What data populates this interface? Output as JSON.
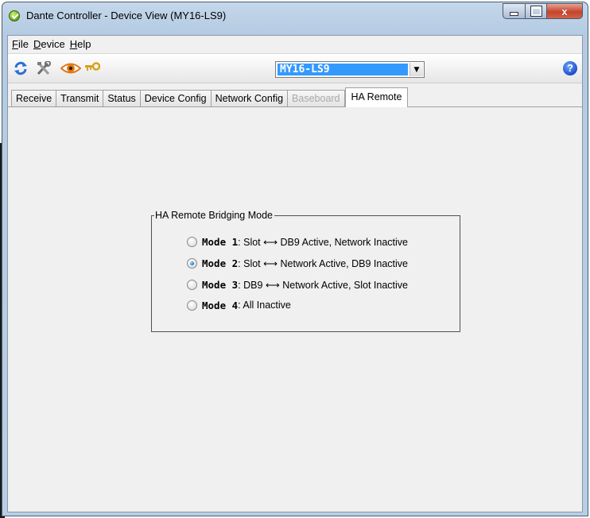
{
  "window": {
    "title": "Dante Controller - Device View (MY16-LS9)",
    "close_glyph": "x"
  },
  "menu": {
    "items": [
      {
        "key": "F",
        "rest": "ile"
      },
      {
        "key": "D",
        "rest": "evice"
      },
      {
        "key": "H",
        "rest": "elp"
      }
    ]
  },
  "toolbar": {
    "icons": [
      "refresh-icon",
      "tools-icon",
      "eye-icon",
      "key-icon"
    ],
    "device": "MY16-LS9",
    "help_label": "?"
  },
  "tabs": [
    {
      "label": "Receive",
      "state": "normal"
    },
    {
      "label": "Transmit",
      "state": "normal"
    },
    {
      "label": "Status",
      "state": "normal"
    },
    {
      "label": "Device Config",
      "state": "normal"
    },
    {
      "label": "Network Config",
      "state": "normal"
    },
    {
      "label": "Baseboard",
      "state": "disabled"
    },
    {
      "label": "HA Remote",
      "state": "active"
    }
  ],
  "ha_remote": {
    "group_title": "HA Remote Bridging Mode",
    "selected_index": 1,
    "options": [
      {
        "name": "Mode 1",
        "desc": ": Slot ⟷ DB9 Active, Network Inactive"
      },
      {
        "name": "Mode 2",
        "desc": ": Slot ⟷ Network Active, DB9 Inactive"
      },
      {
        "name": "Mode 3",
        "desc": ": DB9 ⟷ Network Active, Slot Inactive"
      },
      {
        "name": "Mode 4",
        "desc": ": All Inactive"
      }
    ]
  },
  "colors": {
    "selection": "#3399ff",
    "titlebar": "#b4cbe2",
    "close_button": "#c4442c"
  }
}
